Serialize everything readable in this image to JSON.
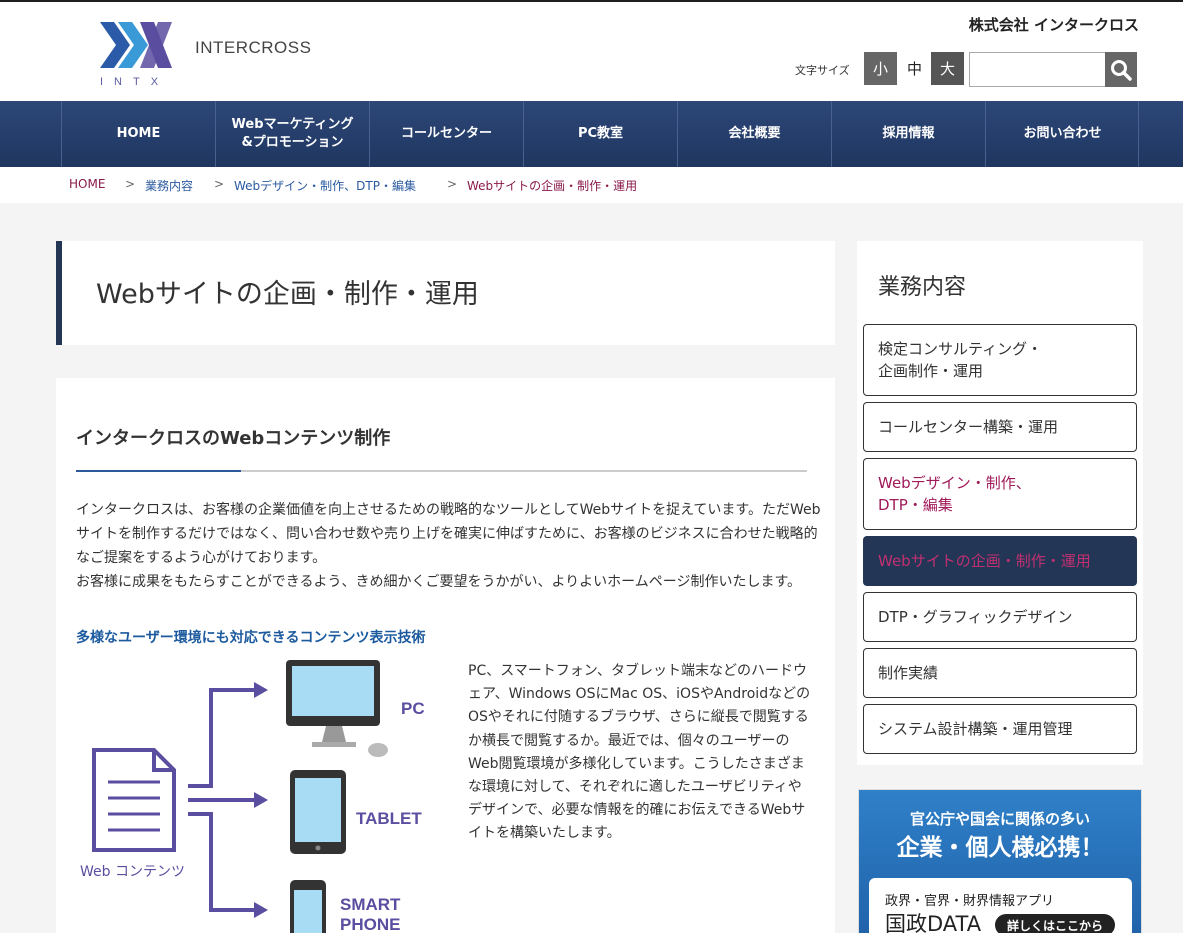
{
  "header": {
    "brand": "INTERCROSS",
    "logo_sub": "INTX",
    "company": "株式会社 インタークロス",
    "font_size_label": "文字サイズ",
    "font_sizes": [
      "小",
      "中",
      "大"
    ],
    "search_placeholder": ""
  },
  "nav": {
    "items": [
      {
        "label": "HOME"
      },
      {
        "label": "Webマーケティング\n&プロモーション"
      },
      {
        "label": "コールセンター"
      },
      {
        "label": "PC教室"
      },
      {
        "label": "会社概要"
      },
      {
        "label": "採用情報"
      },
      {
        "label": "お問い合わせ"
      }
    ]
  },
  "breadcrumb": {
    "home": "HOME",
    "level1": "業務内容",
    "level2": "Webデザイン・制作、DTP・編集",
    "current": "Webサイトの企画・制作・運用",
    "sep": ">"
  },
  "main": {
    "page_title": "Webサイトの企画・制作・運用",
    "section_title": "インタークロスのWebコンテンツ制作",
    "intro_1": "インタークロスは、お客様の企業価値を向上させるための戦略的なツールとしてWebサイトを捉えています。ただWebサイトを制作するだけではなく、問い合わせ数や売り上げを確実に伸ばすために、お客様のビジネスに合わせた戦略的なご提案をするよう心がけております。",
    "intro_2": "お客様に成果をもたらすことができるよう、きめ細かくご要望をうかがい、よりよいホームページ制作いたします。",
    "sub_heading": "多様なユーザー環境にも対応できるコンテンツ表示技術",
    "description": "PC、スマートフォン、タブレット端末などのハードウェア、Windows OSにMac OS、iOSやAndroidなどのOSやそれに付随するブラウザ、さらに縦長で閲覧するか横長で閲覧するか。最近では、個々のユーザーのWeb閲覧環境が多様化しています。こうしたさまざまな環境に対して、それぞれに適したユーザビリティやデザインで、必要な情報を的確にお伝えできるWebサイトを構築いたします。",
    "diagram": {
      "source_label": "Web コンテンツ",
      "targets": [
        "PC",
        "TABLET",
        "SMART",
        "PHONE"
      ]
    }
  },
  "sidebar": {
    "title": "業務内容",
    "items": [
      {
        "label": "検定コンサルティング・\n企画制作・運用"
      },
      {
        "label": "コールセンター構築・運用"
      },
      {
        "label": "Webデザイン・制作、\nDTP・編集"
      },
      {
        "label": "Webサイトの企画・制作・運用"
      },
      {
        "label": "DTP・グラフィックデザイン"
      },
      {
        "label": "制作実績"
      },
      {
        "label": "システム設計構築・運用管理"
      }
    ]
  },
  "banner": {
    "line1": "官公庁や国会に関係の多い",
    "line2": "企業・個人様必携！",
    "app_label": "政界・官界・財界情報アプリ",
    "app_name": "国政DATA",
    "cta": "詳しくはここから"
  },
  "colors": {
    "nav_bg": "#243a66",
    "accent_magenta": "#a01a5a",
    "link_blue": "#2a5aa0",
    "diagram_purple": "#5a4ea0",
    "screen_blue": "#a8dcf4"
  }
}
